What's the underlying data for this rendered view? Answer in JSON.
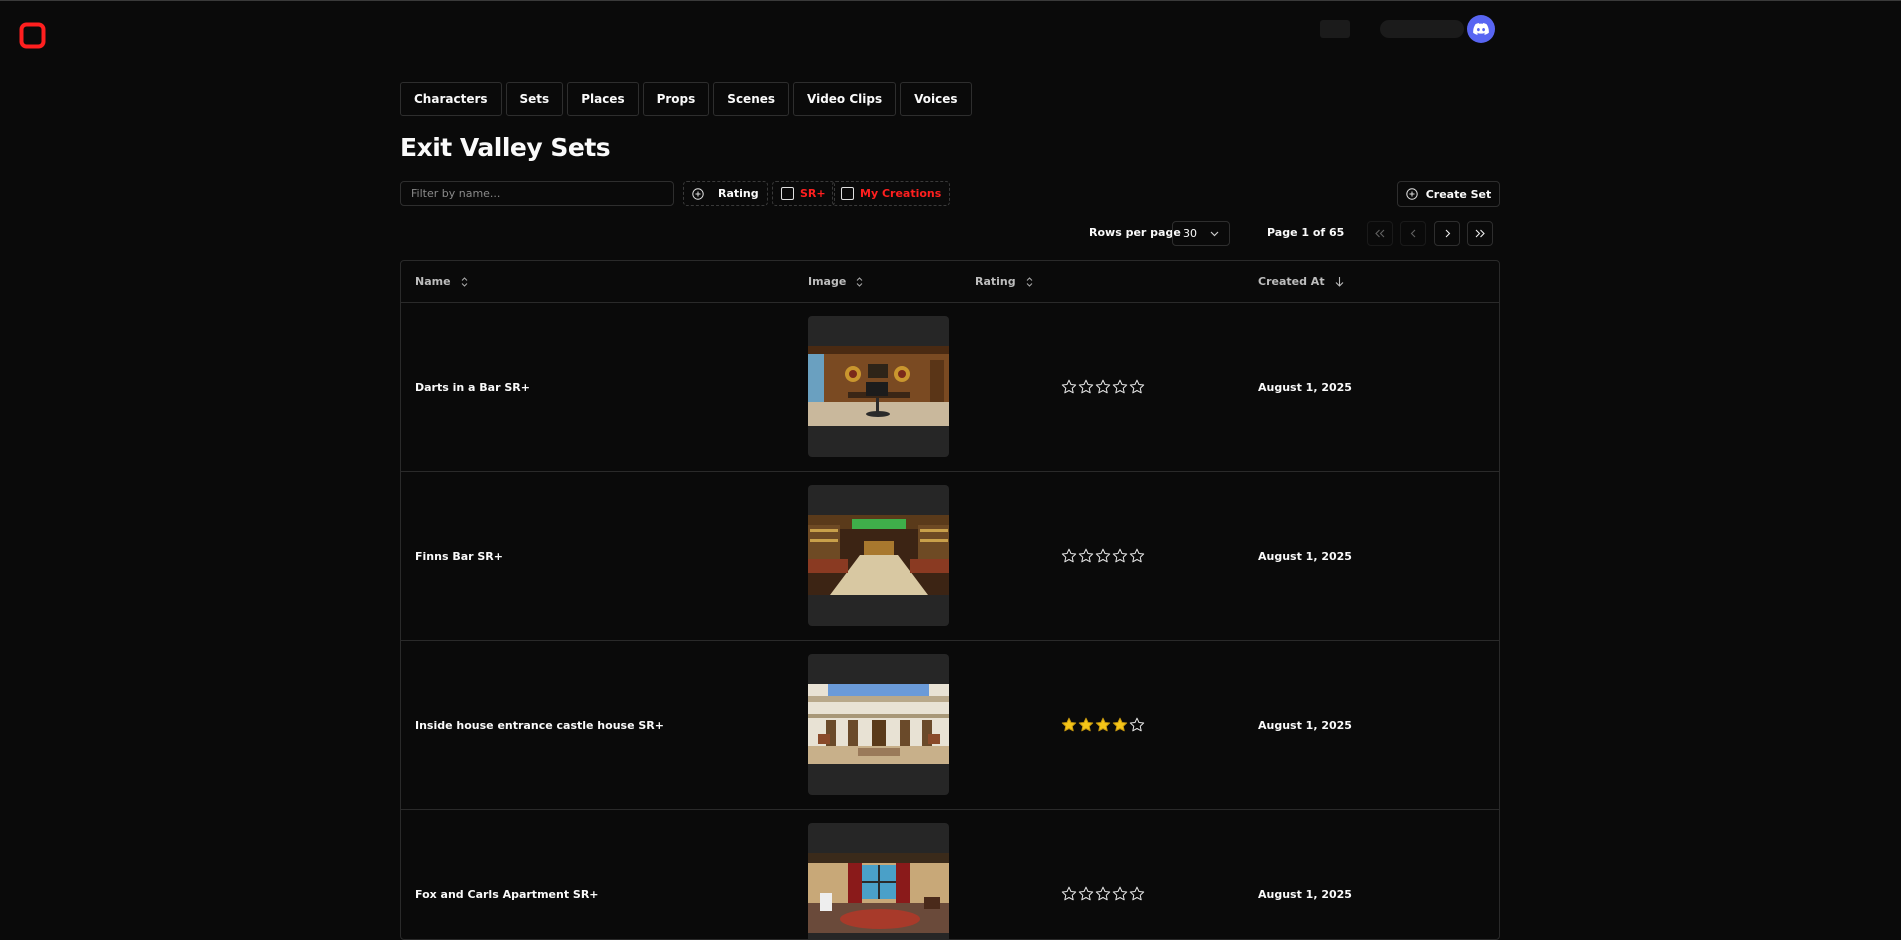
{
  "colors": {
    "accent_red": "#ff1f1f",
    "discord": "#5865f2",
    "star_filled": "#f5c518",
    "background": "#0a0a0a"
  },
  "nav": {
    "tabs": [
      {
        "label": "Characters"
      },
      {
        "label": "Sets"
      },
      {
        "label": "Places"
      },
      {
        "label": "Props"
      },
      {
        "label": "Scenes"
      },
      {
        "label": "Video Clips"
      },
      {
        "label": "Voices"
      }
    ]
  },
  "page": {
    "title": "Exit Valley Sets"
  },
  "toolbar": {
    "filter_placeholder": "Filter by name...",
    "rating_label": "Rating",
    "sr_label": "SR+",
    "my_creations_label": "My Creations",
    "create_label": "Create Set"
  },
  "pagination": {
    "rows_label": "Rows per page",
    "rows_value": "30",
    "page_info": "Page 1 of 65"
  },
  "table": {
    "headers": {
      "name": "Name",
      "image": "Image",
      "rating": "Rating",
      "created": "Created At"
    },
    "rows": [
      {
        "name": "Darts in a Bar SR+",
        "rating": 0,
        "date": "August 1, 2025"
      },
      {
        "name": "Finns Bar SR+",
        "rating": 0,
        "date": "August 1, 2025"
      },
      {
        "name": "Inside house entrance castle house SR+",
        "rating": 4,
        "date": "August 1, 2025"
      },
      {
        "name": "Fox and Carls Apartment SR+",
        "rating": 0,
        "date": "August 1, 2025"
      }
    ]
  }
}
